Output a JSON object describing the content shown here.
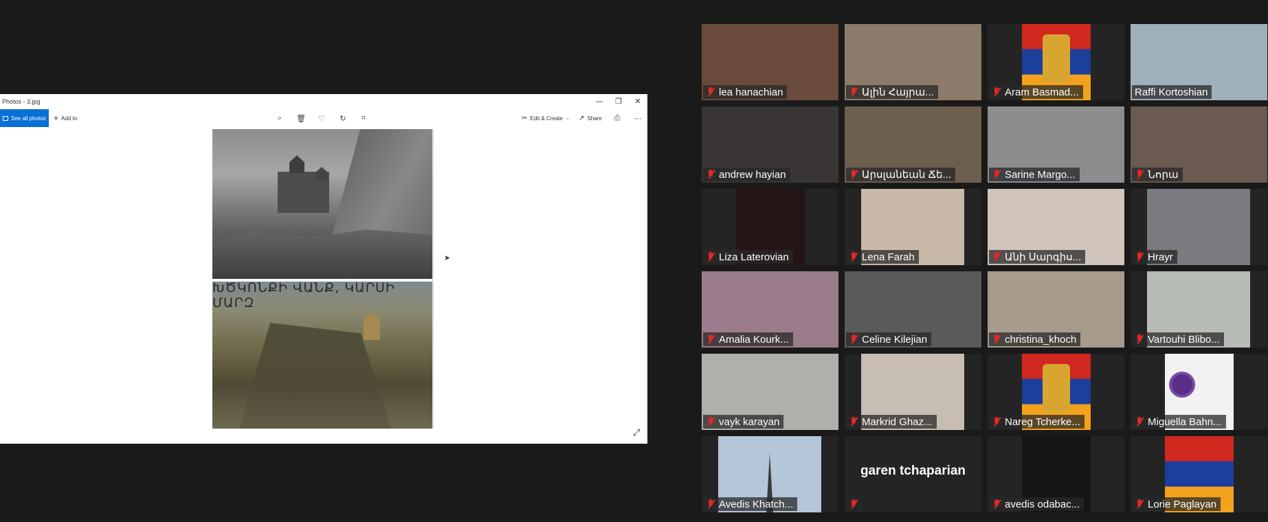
{
  "photos_window": {
    "title": "Photos - 3.jpg",
    "controls": {
      "minimize": "—",
      "restore": "❐",
      "close": "✕"
    },
    "toolbar": {
      "see_all_label": "See all photos",
      "add_to_label": "Add to",
      "edit_create_label": "Edit & Create",
      "share_label": "Share",
      "icons": [
        "zoom-icon",
        "delete-icon",
        "heart-icon",
        "rotate-icon",
        "crop-icon",
        "print-icon",
        "more-icon"
      ]
    },
    "photo": {
      "caption": "ԽԾԿՈՆՔԻ ՎԱՆՔ, ԿԱՐՍԻ ՄԱՐԶ"
    }
  },
  "participants": [
    {
      "name": "lea hanachian",
      "muted": true,
      "bg": "#6a4a3a"
    },
    {
      "name": "Ալին Հայրա...",
      "muted": true,
      "bg": "#8c7a6a"
    },
    {
      "name": "Aram Basmad...",
      "muted": true,
      "bg": "#2a2a2a",
      "avatar": "flag-emblem"
    },
    {
      "name": "Raffi Kortoshian",
      "muted": false,
      "bg": "#9fb0bb",
      "active": true
    },
    {
      "name": "andrew hayian",
      "muted": true,
      "bg": "#3a3535"
    },
    {
      "name": "Արսլանեան Ճե...",
      "muted": true,
      "bg": "#6d5f4f"
    },
    {
      "name": "Sarine Margo...",
      "muted": true,
      "bg": "#8d8d8d"
    },
    {
      "name": "Նորա",
      "muted": true,
      "bg": "#6b5a4f"
    },
    {
      "name": "Liza Laterovian",
      "muted": true,
      "bg": "#241414"
    },
    {
      "name": "Lena Farah",
      "muted": true,
      "bg": "#c9b9a9"
    },
    {
      "name": "Անի Սարգիս...",
      "muted": true,
      "bg": "#d0c4bb"
    },
    {
      "name": "Hrayr",
      "muted": true,
      "bg": "#7a7a80"
    },
    {
      "name": "Amalia Kourk...",
      "muted": true,
      "bg": "#9a7c8c"
    },
    {
      "name": "Celine Kilejian",
      "muted": true,
      "bg": "#5a5a5a"
    },
    {
      "name": "christina_khoch",
      "muted": true,
      "bg": "#a79c8c"
    },
    {
      "name": "Vartouhi Blibo...",
      "muted": true,
      "bg": "#b8bcb6"
    },
    {
      "name": "vayk karayan",
      "muted": true,
      "bg": "#b0b0aa"
    },
    {
      "name": "Markrid Ghaz...",
      "muted": true,
      "bg": "#c7bdb3"
    },
    {
      "name": "Nareg Tcherke...",
      "muted": true,
      "bg": "#2a2a2a",
      "avatar": "flag-emblem"
    },
    {
      "name": "Miguella Bahn...",
      "muted": true,
      "bg": "#f2f2f2",
      "avatar": "forget-me-not"
    },
    {
      "name": "Avedis Khatch...",
      "muted": true,
      "bg": "#b4c6d8",
      "avatar": "monument"
    },
    {
      "name": "",
      "muted": true,
      "bg": "#242424",
      "big_name": "garen tchaparian"
    },
    {
      "name": "avedis odabac...",
      "muted": true,
      "bg": "#151515"
    },
    {
      "name": "Lorie Paglayan",
      "muted": true,
      "bg": "#2a2a2a",
      "avatar": "flag"
    }
  ],
  "colors": {
    "accent": "#0a6fd6",
    "active_speaker": "#c5e34a",
    "muted_red": "#e02828"
  }
}
